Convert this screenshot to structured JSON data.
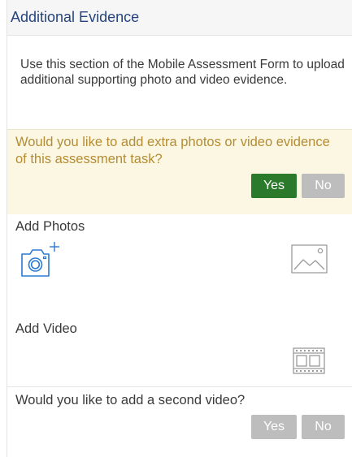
{
  "header": {
    "title": "Additional Evidence"
  },
  "intro": {
    "text": "Use this section of the Mobile Assessment Form to upload additional supporting photo and video evidence."
  },
  "extra_evidence_question": {
    "text": "Would you like to add extra photos or video evidence of this assessment task?",
    "yes_label": "Yes",
    "no_label": "No",
    "selected": "Yes"
  },
  "photos": {
    "label": "Add Photos",
    "camera_icon": "camera-add-icon",
    "gallery_icon": "image-gallery-icon"
  },
  "video": {
    "label": "Add Video",
    "film_icon": "film-strip-icon"
  },
  "second_video_question": {
    "text": "Would you like to add a second video?",
    "yes_label": "Yes",
    "no_label": "No"
  },
  "colors": {
    "header_text": "#25447e",
    "question_bg": "#fbf7e3",
    "question_text": "#b48d34",
    "yes_active": "#2b7a2b",
    "inactive_button": "#bdbdbd",
    "icon_blue": "#2a7ad2"
  }
}
